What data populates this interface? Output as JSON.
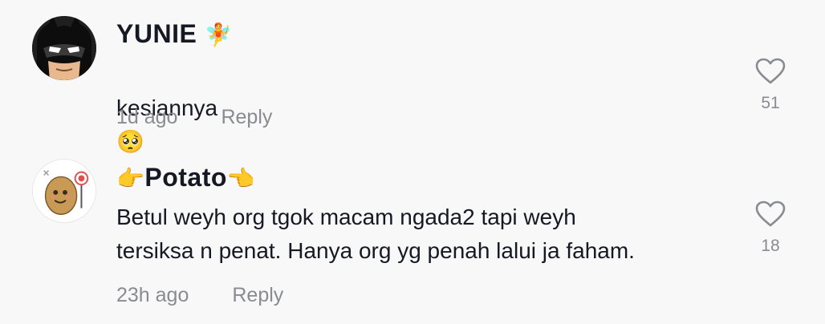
{
  "comments": [
    {
      "username": "YUNIE",
      "username_suffix_emoji": "🧚",
      "avatar_icon": "batman-avatar-icon",
      "text": "kesiannya",
      "text_emoji": "🥺",
      "time": "1d ago",
      "reply_label": "Reply",
      "likes": "51"
    },
    {
      "username": "Potato",
      "username_prefix_emoji": "👉",
      "username_suffix_emoji": "👈",
      "avatar_icon": "potato-avatar-icon",
      "text": "Betul weyh org tgok macam ngada2 tapi weyh\ntersiksa n penat. Hanya org yg penah lalui ja faham.",
      "time": "23h ago",
      "reply_label": "Reply",
      "likes": "18"
    }
  ],
  "colors": {
    "background": "#f8f8f8",
    "primary_text": "#161823",
    "secondary_text": "#8a8b91"
  }
}
